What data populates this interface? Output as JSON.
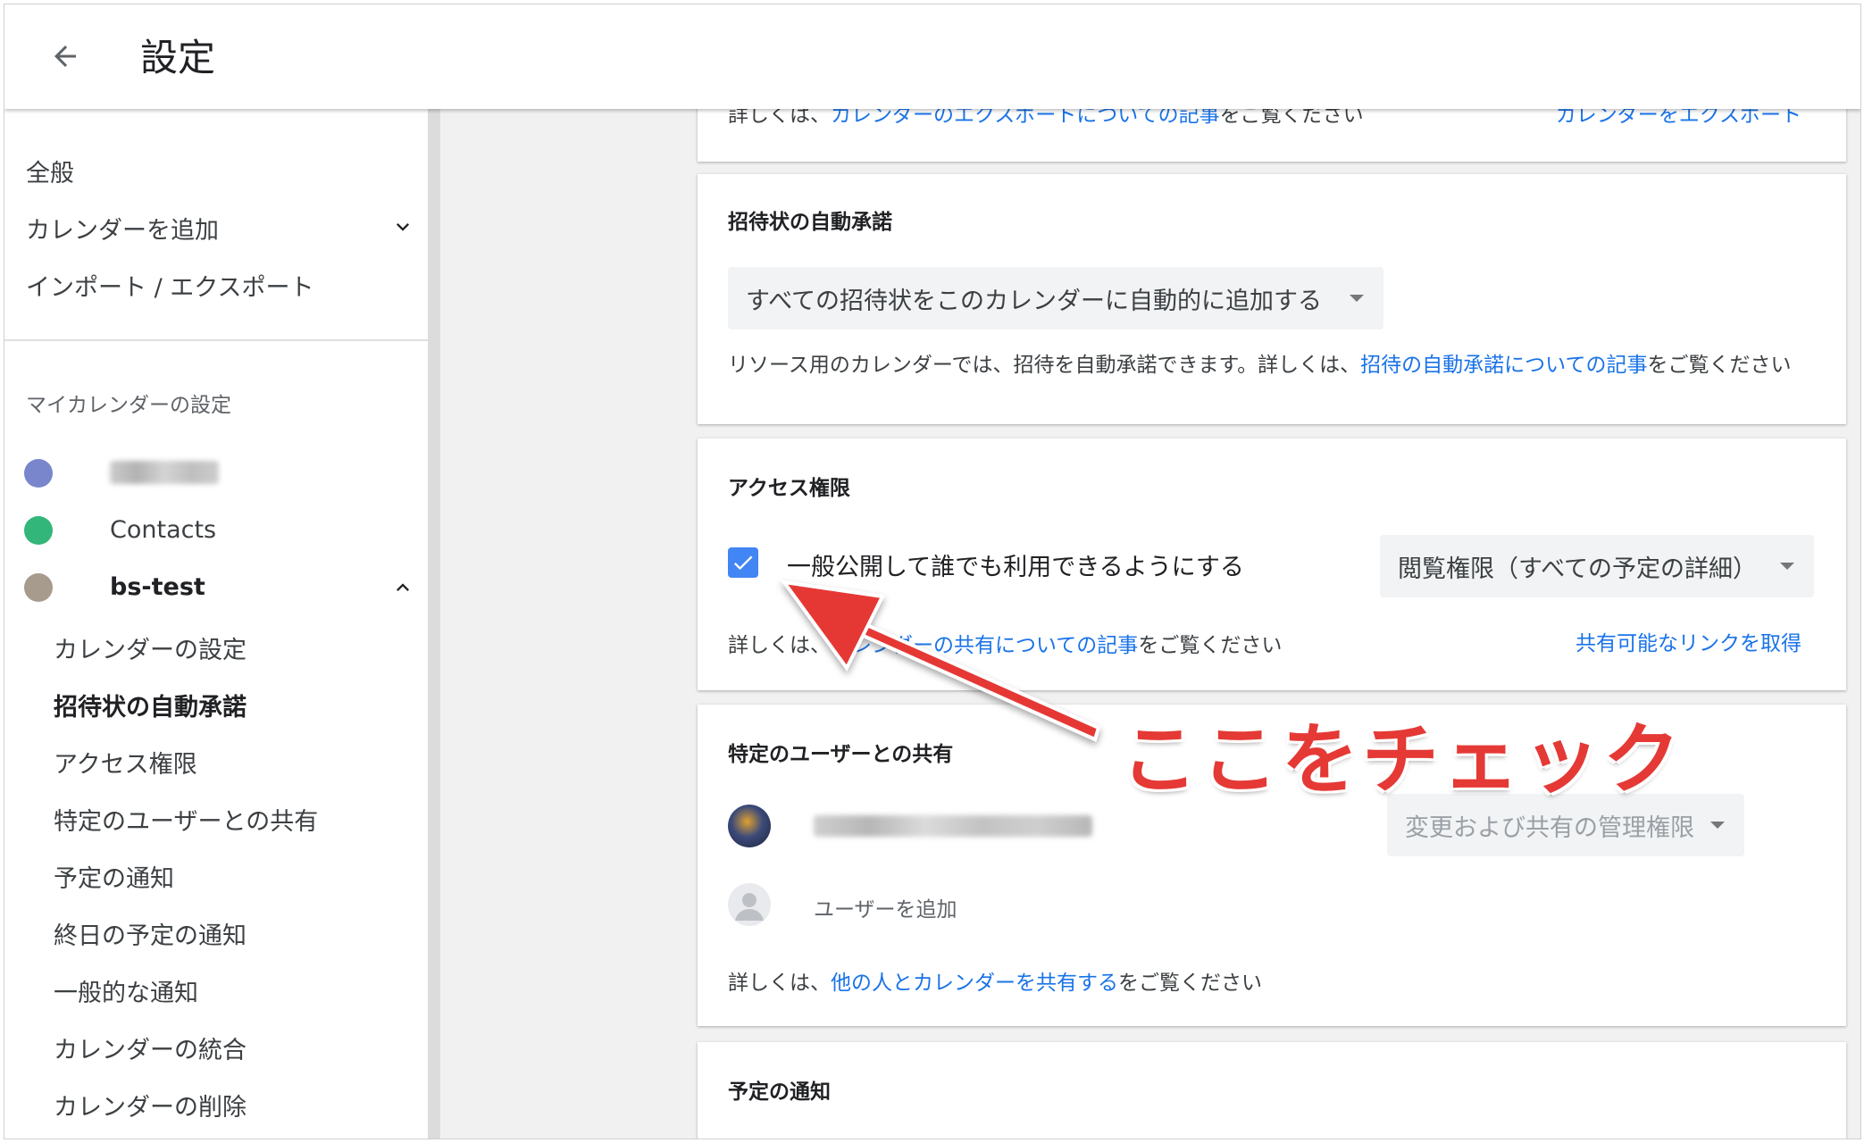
{
  "header": {
    "title": "設定"
  },
  "sidebar": {
    "items": [
      "全般",
      "カレンダーを追加",
      "インポート / エクスポート"
    ],
    "section_heading": "マイカレンダーの設定",
    "calendars": [
      {
        "name": "",
        "color": "#7986cb"
      },
      {
        "name": "Contacts",
        "color": "#33b679"
      },
      {
        "name": "bs-test",
        "color": "#a79b8e"
      }
    ],
    "sub_items": [
      "カレンダーの設定",
      "招待状の自動承諾",
      "アクセス権限",
      "特定のユーザーとの共有",
      "予定の通知",
      "終日の予定の通知",
      "一般的な通知",
      "カレンダーの統合",
      "カレンダーの削除"
    ]
  },
  "export_card": {
    "text_prefix": "詳しくは、",
    "link": "カレンダーのエクスポートについての記事",
    "text_suffix": "をご覧ください",
    "action": "カレンダーをエクスポート"
  },
  "auto_accept": {
    "title": "招待状の自動承諾",
    "select_value": "すべての招待状をこのカレンダーに自動的に追加する",
    "desc_prefix": "リソース用のカレンダーでは、招待を自動承諾できます。詳しくは、",
    "desc_link": "招待の自動承諾についての記事",
    "desc_suffix": "をご覧ください"
  },
  "access": {
    "title": "アクセス権限",
    "checkbox_label": "一般公開して誰でも利用できるようにする",
    "permission": "閲覧権限（すべての予定の詳細）",
    "help_prefix": "詳しくは、",
    "help_link": "カレンダーの共有についての記事",
    "help_suffix": "をご覧ください",
    "share_link": "共有可能なリンクを取得"
  },
  "sharing": {
    "title": "特定のユーザーとの共有",
    "user_permission": "変更および共有の管理権限",
    "add_user": "ユーザーを追加",
    "help_prefix": "詳しくは、",
    "help_link": "他の人とカレンダーを共有する",
    "help_suffix": "をご覧ください"
  },
  "notifications": {
    "title": "予定の通知"
  },
  "annotation": {
    "text": "ここをチェック"
  },
  "colors": {
    "link": "#1a73e8",
    "checkbox": "#4285f4",
    "annotation": "#e53935"
  }
}
